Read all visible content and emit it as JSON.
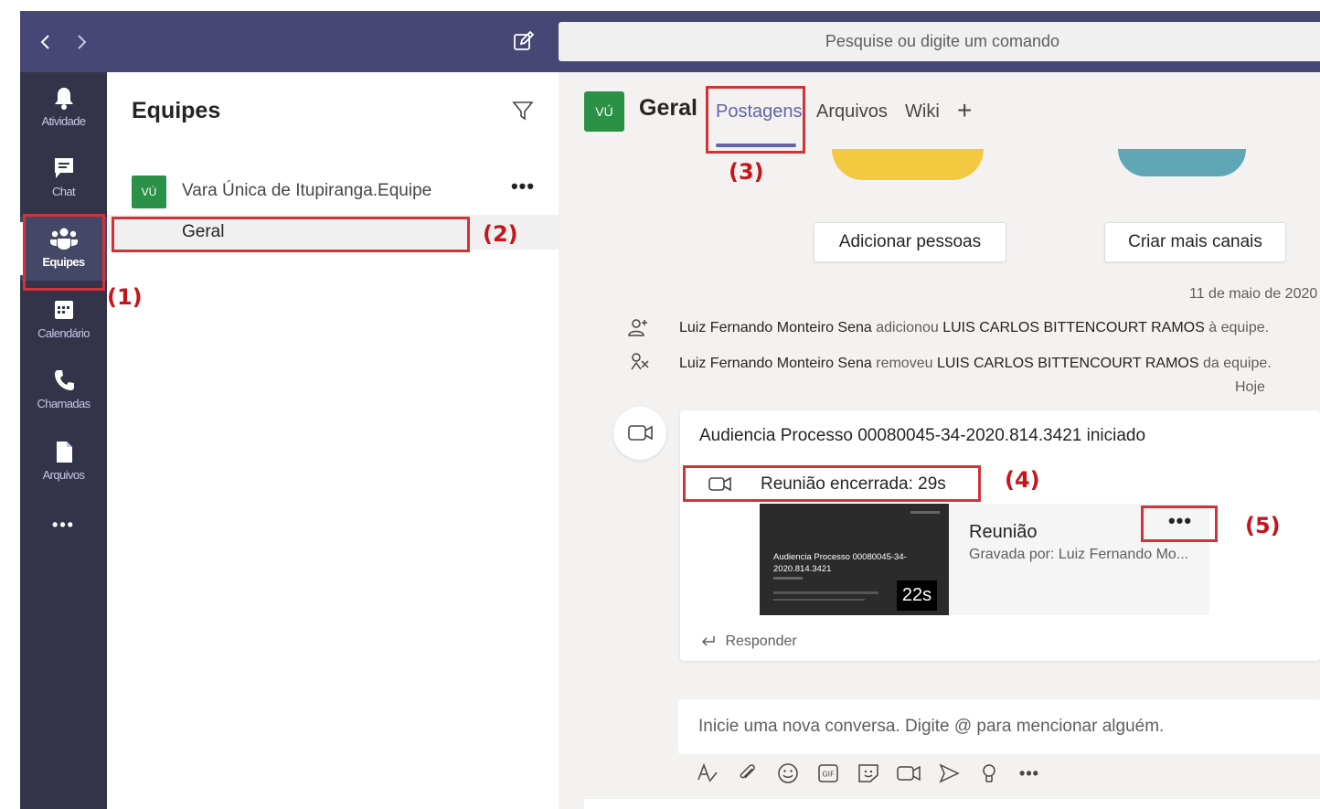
{
  "topbar": {
    "back_icon": "chevron-left-icon",
    "forward_icon": "chevron-right-icon",
    "compose_icon": "compose-icon",
    "search_placeholder": "Pesquise ou digite um comando"
  },
  "rail": {
    "items": [
      {
        "label": "Atividade",
        "icon": "bell-icon"
      },
      {
        "label": "Chat",
        "icon": "chat-icon"
      },
      {
        "label": "Equipes",
        "icon": "teams-icon",
        "active": true
      },
      {
        "label": "Calendário",
        "icon": "calendar-icon"
      },
      {
        "label": "Chamadas",
        "icon": "phone-icon"
      },
      {
        "label": "Arquivos",
        "icon": "file-icon"
      }
    ],
    "more": "•••"
  },
  "teams_panel": {
    "title": "Equipes",
    "filter_icon": "filter-icon",
    "team": {
      "avatar": "VÚ",
      "name": "Vara Única de Itupiranga.Equipe",
      "more": "•••"
    },
    "channel": {
      "name": "Geral"
    }
  },
  "channel_header": {
    "avatar": "VÚ",
    "title": "Geral",
    "tabs": [
      "Postagens",
      "Arquivos",
      "Wiki"
    ],
    "active_tab": "Postagens",
    "add_tab": "+"
  },
  "actions": {
    "add_people": "Adicionar pessoas",
    "create_channels": "Criar mais canais"
  },
  "feed": {
    "date_1": "11 de maio de 2020",
    "event_1": {
      "actor": "Luiz Fernando Monteiro Sena",
      "verb": "adicionou",
      "target": "LUIS CARLOS BITTENCOURT RAMOS",
      "suffix": "à equipe."
    },
    "event_2": {
      "actor": "Luiz Fernando Monteiro Sena",
      "verb": "removeu",
      "target": "LUIS CARLOS BITTENCOURT RAMOS",
      "suffix": "da equipe."
    },
    "date_2": "Hoje"
  },
  "post": {
    "title": "Audiencia Processo 00080045-34-2020.814.3421 iniciado",
    "meeting_ended": "Reunião encerrada: 29s",
    "recording": {
      "thumb_title": "Audiencia Processo 00080045-34-2020.814.3421",
      "duration": "22s",
      "title": "Reunião",
      "subtitle": "Gravada por: Luiz Fernando Mo...",
      "more": "•••"
    },
    "reply": "Responder"
  },
  "compose": {
    "placeholder": "Inicie uma nova conversa. Digite @ para mencionar alguém.",
    "toolbar": [
      "format-icon",
      "attach-icon",
      "emoji-icon",
      "gif-icon",
      "sticker-icon",
      "meet-now-icon",
      "send-icon",
      "praise-icon",
      "more-icon"
    ],
    "gif_label": "GIF",
    "more": "•••"
  },
  "annotations": [
    "(1)",
    "(2)",
    "(3)",
    "(4)",
    "(5)"
  ],
  "colors": {
    "rail": "#33344a",
    "topbar": "#464775",
    "accent": "#6264a7",
    "avatar": "#2b9147",
    "annotation": "#d13438"
  }
}
